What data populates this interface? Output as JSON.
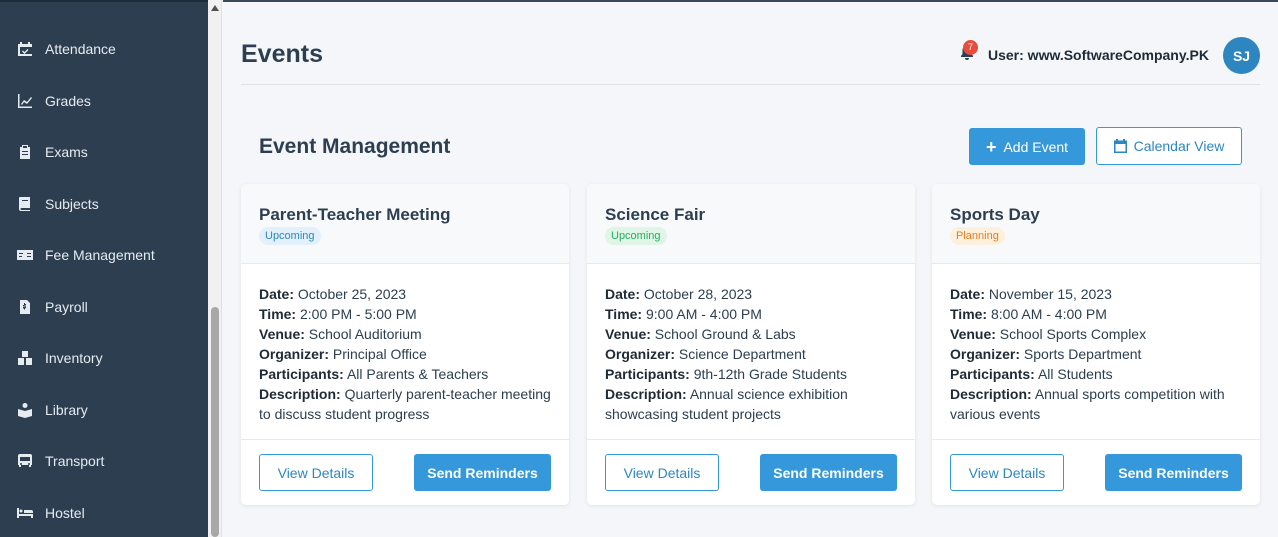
{
  "sidebar": {
    "items": [
      {
        "label": "Attendance",
        "icon": "calendar-check-icon"
      },
      {
        "label": "Grades",
        "icon": "line-chart-icon"
      },
      {
        "label": "Exams",
        "icon": "clipboard-icon"
      },
      {
        "label": "Subjects",
        "icon": "book-icon"
      },
      {
        "label": "Fee Management",
        "icon": "money-card-icon"
      },
      {
        "label": "Payroll",
        "icon": "file-invoice-icon"
      },
      {
        "label": "Inventory",
        "icon": "boxes-icon"
      },
      {
        "label": "Library",
        "icon": "book-reader-icon"
      },
      {
        "label": "Transport",
        "icon": "bus-icon"
      },
      {
        "label": "Hostel",
        "icon": "bed-icon"
      }
    ]
  },
  "header": {
    "title": "Events",
    "notification_count": "7",
    "user_label": "User: www.SoftwareCompany.PK",
    "avatar_initials": "SJ"
  },
  "section": {
    "title": "Event Management",
    "add_label": "Add Event",
    "calendar_label": "Calendar View"
  },
  "field_labels": {
    "date": "Date:",
    "time": "Time:",
    "venue": "Venue:",
    "organizer": "Organizer:",
    "participants": "Participants:",
    "description": "Description:"
  },
  "actions": {
    "view_label": "View Details",
    "remind_label": "Send Reminders"
  },
  "events": [
    {
      "title": "Parent-Teacher Meeting",
      "status": "Upcoming",
      "date": "October 25, 2023",
      "time": "2:00 PM - 5:00 PM",
      "venue": "School Auditorium",
      "organizer": "Principal Office",
      "participants": "All Parents & Teachers",
      "description": "Quarterly parent-teacher meeting to discuss student progress"
    },
    {
      "title": "Science Fair",
      "status": "Upcoming",
      "date": "October 28, 2023",
      "time": "9:00 AM - 4:00 PM",
      "venue": "School Ground & Labs",
      "organizer": "Science Department",
      "participants": "9th-12th Grade Students",
      "description": "Annual science exhibition showcasing student projects"
    },
    {
      "title": "Sports Day",
      "status": "Planning",
      "date": "November 15, 2023",
      "time": "8:00 AM - 4:00 PM",
      "venue": "School Sports Complex",
      "organizer": "Sports Department",
      "participants": "All Students",
      "description": "Annual sports competition with various events"
    }
  ],
  "colors": {
    "sidebar_bg": "#2c3e50",
    "accent": "#3498db",
    "badge_red": "#e74c3c"
  }
}
